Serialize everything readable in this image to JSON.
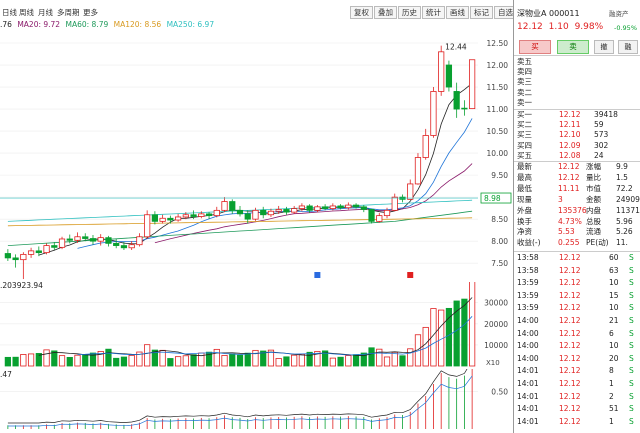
{
  "tabs": [
    {
      "label": "日线"
    },
    {
      "label": "周线"
    },
    {
      "label": "月线"
    },
    {
      "label": "多周期"
    },
    {
      "label": "更多"
    }
  ],
  "toolbar": [
    "复权",
    "叠加",
    "历史",
    "统计",
    "画线",
    "标记",
    "自选"
  ],
  "ma": {
    "ma_prefix": ".76",
    "ma20": "MA20: 9.72",
    "ma60": "MA60: 8.79",
    "ma120": "MA120: 8.56",
    "ma250": "MA250: 6.97"
  },
  "colors": {
    "up": "#e02020",
    "down": "#08a030",
    "ma5": "#222222",
    "ma10": "#1e74d8",
    "ma20": "#8a1a6a",
    "ma60": "#1e9a5a",
    "ma120": "#d89a20",
    "ma250": "#30c0c0"
  },
  "chart_data": {
    "type": "candlestick",
    "y_ticks": [
      "12.50",
      "12.00",
      "11.50",
      "11.00",
      "10.50",
      "10.00",
      "9.50",
      "9.00",
      "8.50",
      "8.00",
      "7.50"
    ],
    "ylim": [
      7.3,
      12.75
    ],
    "high_label": "12.44",
    "low_label": "7.14",
    "current_price_tag": "8.98",
    "candles": [
      {
        "o": 7.72,
        "c": 7.62,
        "h": 7.82,
        "l": 7.55
      },
      {
        "o": 7.62,
        "c": 7.58,
        "h": 7.7,
        "l": 7.4
      },
      {
        "o": 7.58,
        "c": 7.7,
        "h": 7.75,
        "l": 7.14
      },
      {
        "o": 7.7,
        "c": 7.78,
        "h": 7.85,
        "l": 7.62
      },
      {
        "o": 7.78,
        "c": 7.74,
        "h": 7.88,
        "l": 7.66
      },
      {
        "o": 7.74,
        "c": 7.9,
        "h": 7.95,
        "l": 7.7
      },
      {
        "o": 7.9,
        "c": 7.86,
        "h": 7.98,
        "l": 7.8
      },
      {
        "o": 7.86,
        "c": 8.05,
        "h": 8.1,
        "l": 7.82
      },
      {
        "o": 8.05,
        "c": 8.02,
        "h": 8.15,
        "l": 7.95
      },
      {
        "o": 8.02,
        "c": 8.1,
        "h": 8.2,
        "l": 7.96
      },
      {
        "o": 8.1,
        "c": 8.06,
        "h": 8.18,
        "l": 8.0
      },
      {
        "o": 8.06,
        "c": 8.0,
        "h": 8.14,
        "l": 7.92
      },
      {
        "o": 8.0,
        "c": 8.08,
        "h": 8.16,
        "l": 7.9
      },
      {
        "o": 8.08,
        "c": 7.95,
        "h": 8.12,
        "l": 7.88
      },
      {
        "o": 7.95,
        "c": 7.9,
        "h": 8.05,
        "l": 7.84
      },
      {
        "o": 7.9,
        "c": 7.85,
        "h": 7.98,
        "l": 7.8
      },
      {
        "o": 7.85,
        "c": 7.92,
        "h": 8.0,
        "l": 7.8
      },
      {
        "o": 7.92,
        "c": 8.1,
        "h": 8.18,
        "l": 7.88
      },
      {
        "o": 8.1,
        "c": 8.6,
        "h": 8.7,
        "l": 8.05
      },
      {
        "o": 8.6,
        "c": 8.45,
        "h": 8.68,
        "l": 8.38
      },
      {
        "o": 8.45,
        "c": 8.52,
        "h": 8.6,
        "l": 8.4
      },
      {
        "o": 8.52,
        "c": 8.48,
        "h": 8.58,
        "l": 8.4
      },
      {
        "o": 8.48,
        "c": 8.55,
        "h": 8.62,
        "l": 8.44
      },
      {
        "o": 8.55,
        "c": 8.6,
        "h": 8.66,
        "l": 8.5
      },
      {
        "o": 8.6,
        "c": 8.56,
        "h": 8.7,
        "l": 8.5
      },
      {
        "o": 8.56,
        "c": 8.62,
        "h": 8.68,
        "l": 8.52
      },
      {
        "o": 8.62,
        "c": 8.58,
        "h": 8.66,
        "l": 8.5
      },
      {
        "o": 8.58,
        "c": 8.7,
        "h": 8.78,
        "l": 8.54
      },
      {
        "o": 8.7,
        "c": 8.9,
        "h": 9.0,
        "l": 8.66
      },
      {
        "o": 8.9,
        "c": 8.7,
        "h": 8.95,
        "l": 8.62
      },
      {
        "o": 8.7,
        "c": 8.62,
        "h": 8.8,
        "l": 8.56
      },
      {
        "o": 8.62,
        "c": 8.5,
        "h": 8.7,
        "l": 8.4
      },
      {
        "o": 8.5,
        "c": 8.7,
        "h": 8.76,
        "l": 8.46
      },
      {
        "o": 8.7,
        "c": 8.6,
        "h": 8.78,
        "l": 8.52
      },
      {
        "o": 8.6,
        "c": 8.68,
        "h": 8.74,
        "l": 8.55
      },
      {
        "o": 8.68,
        "c": 8.72,
        "h": 8.8,
        "l": 8.62
      },
      {
        "o": 8.72,
        "c": 8.66,
        "h": 8.78,
        "l": 8.6
      },
      {
        "o": 8.66,
        "c": 8.74,
        "h": 8.8,
        "l": 8.62
      },
      {
        "o": 8.74,
        "c": 8.8,
        "h": 8.86,
        "l": 8.68
      },
      {
        "o": 8.8,
        "c": 8.7,
        "h": 8.84,
        "l": 8.64
      },
      {
        "o": 8.7,
        "c": 8.78,
        "h": 8.82,
        "l": 8.66
      },
      {
        "o": 8.78,
        "c": 8.74,
        "h": 8.84,
        "l": 8.7
      },
      {
        "o": 8.74,
        "c": 8.8,
        "h": 8.86,
        "l": 8.7
      },
      {
        "o": 8.8,
        "c": 8.76,
        "h": 8.84,
        "l": 8.72
      },
      {
        "o": 8.76,
        "c": 8.82,
        "h": 8.88,
        "l": 8.72
      },
      {
        "o": 8.82,
        "c": 8.78,
        "h": 8.86,
        "l": 8.74
      },
      {
        "o": 8.78,
        "c": 8.72,
        "h": 8.82,
        "l": 8.66
      },
      {
        "o": 8.72,
        "c": 8.45,
        "h": 8.74,
        "l": 8.4
      },
      {
        "o": 8.45,
        "c": 8.58,
        "h": 8.64,
        "l": 8.42
      },
      {
        "o": 8.58,
        "c": 8.7,
        "h": 8.76,
        "l": 8.52
      },
      {
        "o": 8.7,
        "c": 9.0,
        "h": 9.08,
        "l": 8.68
      },
      {
        "o": 9.0,
        "c": 8.95,
        "h": 9.06,
        "l": 8.88
      },
      {
        "o": 8.95,
        "c": 9.3,
        "h": 9.4,
        "l": 8.94
      },
      {
        "o": 9.3,
        "c": 9.9,
        "h": 10.0,
        "l": 9.28
      },
      {
        "o": 9.9,
        "c": 10.4,
        "h": 10.55,
        "l": 9.85
      },
      {
        "o": 10.4,
        "c": 11.4,
        "h": 11.5,
        "l": 10.35
      },
      {
        "o": 11.4,
        "c": 12.3,
        "h": 12.44,
        "l": 11.3
      },
      {
        "o": 12.0,
        "c": 11.5,
        "h": 12.1,
        "l": 11.4
      },
      {
        "o": 11.4,
        "c": 11.0,
        "h": 11.6,
        "l": 10.8
      },
      {
        "o": 11.02,
        "c": 11.01,
        "h": 11.2,
        "l": 10.85
      },
      {
        "o": 11.01,
        "c": 12.12,
        "h": 12.12,
        "l": 11.0
      }
    ],
    "volume": {
      "title": ".203923.94",
      "y_ticks": [
        "30000",
        "20000",
        "10000"
      ],
      "x10": "X10",
      "ylim": [
        0,
        36000
      ]
    },
    "indicator": {
      "title": ".47",
      "y_ticks": [
        "0.50"
      ]
    }
  },
  "quote": {
    "name": "深物业A 000011",
    "price": "12.12",
    "change": "1.10",
    "pct": "9.98%",
    "buy_btn": "买",
    "sell_btn": "卖",
    "btn3": "撤",
    "btn4": "融",
    "top_right": "融资产",
    "top_right_pct": "-0.95%",
    "ask_labels": [
      "卖五",
      "卖四",
      "卖三",
      "卖二",
      "卖一"
    ],
    "bids": [
      {
        "label": "买一",
        "price": "12.12",
        "vol": "39418"
      },
      {
        "label": "买二",
        "price": "12.11",
        "vol": "59"
      },
      {
        "label": "买三",
        "price": "12.10",
        "vol": "573"
      },
      {
        "label": "买四",
        "price": "12.09",
        "vol": "302"
      },
      {
        "label": "买五",
        "price": "12.08",
        "vol": "24"
      }
    ],
    "stats": [
      {
        "l1": "最新",
        "v1": "12.12",
        "l2": "涨幅",
        "v2": "9.9"
      },
      {
        "l1": "最高",
        "v1": "12.12",
        "l2": "量比",
        "v2": "1.5"
      },
      {
        "l1": "最低",
        "v1": "11.11",
        "l2": "市值",
        "v2": "72.2"
      },
      {
        "l1": "现量",
        "v1": "3",
        "l2": "金额",
        "v2": "24909"
      },
      {
        "l1": "外盘",
        "v1": "135376",
        "l2": "内盘",
        "v2": "11371"
      },
      {
        "l1": "换手",
        "v1": "4.73%",
        "l2": "总股",
        "v2": "5.96"
      },
      {
        "l1": "净资",
        "v1": "5.53",
        "l2": "流通",
        "v2": "5.26"
      },
      {
        "l1": "收益(-)",
        "v1": "0.255",
        "l2": "PE(动)",
        "v2": "11."
      }
    ],
    "ticks": [
      {
        "t": "13:58",
        "p": "12.12",
        "v": "60",
        "s": "S"
      },
      {
        "t": "13:58",
        "p": "12.12",
        "v": "63",
        "s": "S"
      },
      {
        "t": "13:59",
        "p": "12.12",
        "v": "10",
        "s": "S"
      },
      {
        "t": "13:59",
        "p": "12.12",
        "v": "15",
        "s": "S"
      },
      {
        "t": "13:59",
        "p": "12.12",
        "v": "10",
        "s": "S"
      },
      {
        "t": "14:00",
        "p": "12.12",
        "v": "21",
        "s": "S"
      },
      {
        "t": "14:00",
        "p": "12.12",
        "v": "6",
        "s": "S"
      },
      {
        "t": "14:00",
        "p": "12.12",
        "v": "10",
        "s": "S"
      },
      {
        "t": "14:00",
        "p": "12.12",
        "v": "20",
        "s": "S"
      },
      {
        "t": "14:01",
        "p": "12.12",
        "v": "8",
        "s": "S"
      },
      {
        "t": "14:01",
        "p": "12.12",
        "v": "1",
        "s": "S"
      },
      {
        "t": "14:01",
        "p": "12.12",
        "v": "2",
        "s": "S"
      },
      {
        "t": "14:01",
        "p": "12.12",
        "v": "51",
        "s": "S"
      },
      {
        "t": "14:01",
        "p": "12.12",
        "v": "1",
        "s": "S"
      }
    ]
  }
}
